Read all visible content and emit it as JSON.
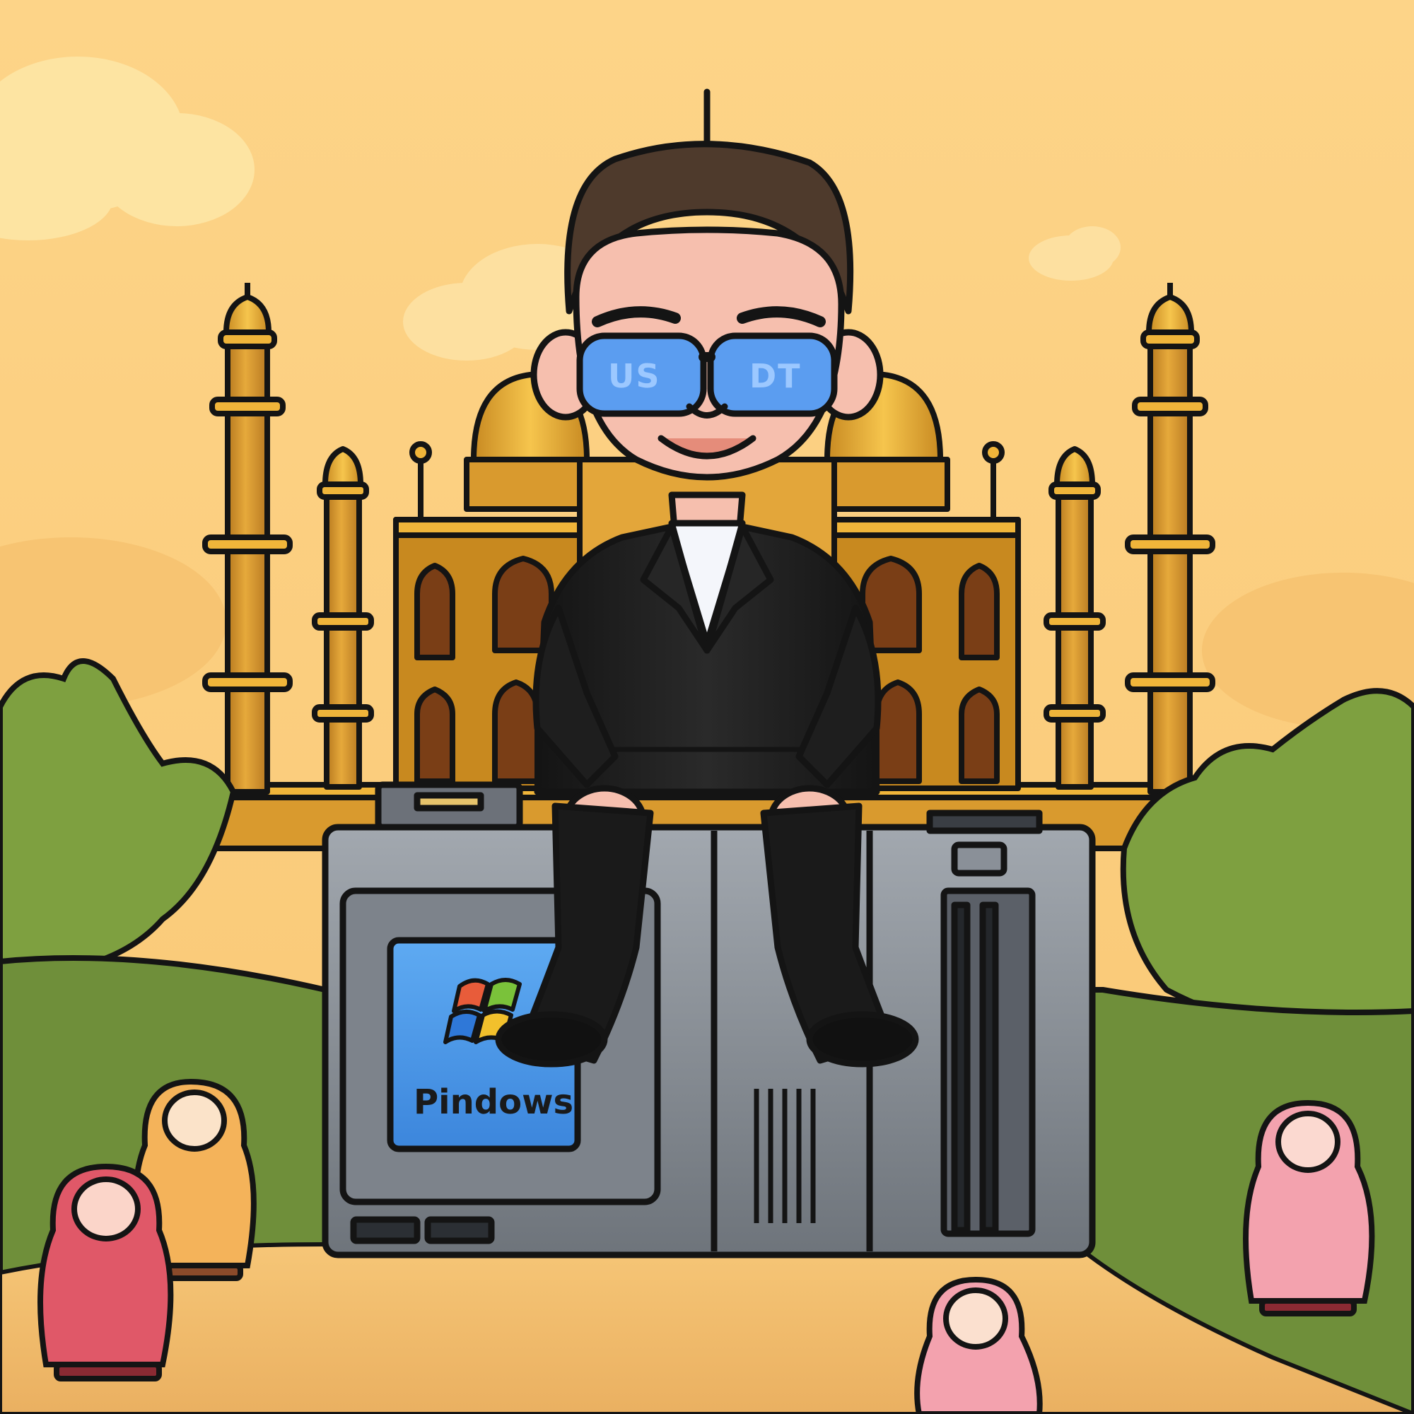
{
  "scene": {
    "lens_left_text": "US",
    "lens_right_text": "DT",
    "screen_brand_text": "Pindows",
    "palette": {
      "sky": "#fcd283",
      "cloud": "#fde6a6",
      "bush": "#7ea040",
      "grass": "#6f8f3a",
      "path": "#f2bd6a",
      "palace_gold": "#d99a2e",
      "dome_gold": "#f0b53a",
      "pc_grey": "#8e949b",
      "screen_blue": "#4a9be8",
      "suit": "#1e1e1e",
      "skin": "#f6bfae",
      "hair": "#4e3a2c",
      "lens_blue": "#5b9df0",
      "outline": "#141414"
    }
  }
}
